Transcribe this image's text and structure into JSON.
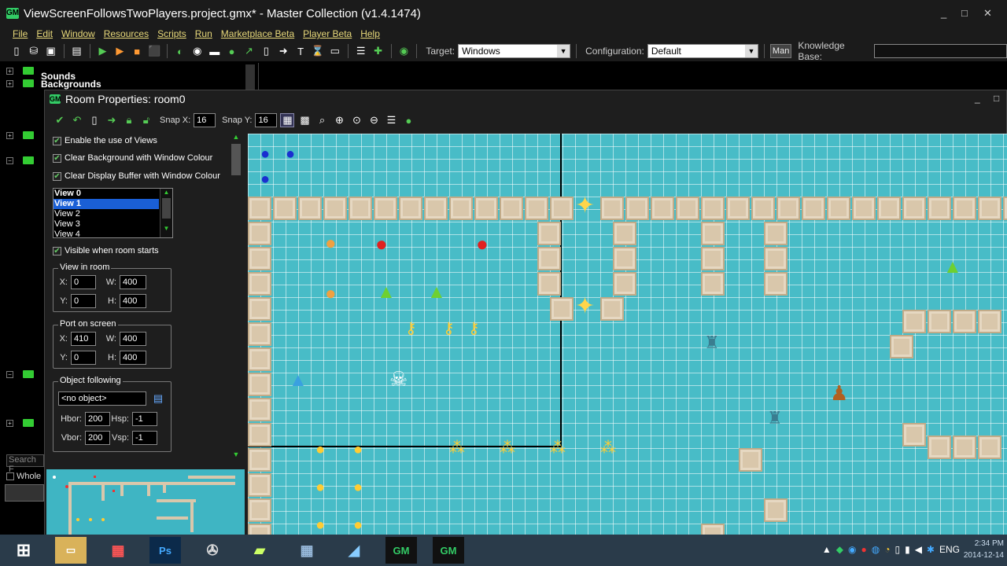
{
  "app": {
    "title": "ViewScreenFollowsTwoPlayers.project.gmx* - Master Collection (v1.4.1474)",
    "logo_text": "GM",
    "window_controls": [
      "_",
      "□",
      "✕"
    ]
  },
  "menu": [
    "File",
    "Edit",
    "Window",
    "Resources",
    "Scripts",
    "Run",
    "Marketplace Beta",
    "Player Beta",
    "Help"
  ],
  "toolbar": {
    "target_label": "Target:",
    "target_value": "Windows",
    "config_label": "Configuration:",
    "config_value": "Default",
    "man_label": "Man",
    "kb_label": "Knowledge Base:",
    "kb_value": ""
  },
  "tree": {
    "items": [
      {
        "label": "Sounds",
        "expanded": false
      },
      {
        "label": "Backgrounds",
        "expanded": false
      }
    ],
    "search_placeholder": "Search F",
    "whole_word_label": "Whole"
  },
  "room": {
    "title": "Room Properties: room0",
    "window_controls": [
      "_",
      "□"
    ],
    "snap_x_label": "Snap X:",
    "snap_x": "16",
    "snap_y_label": "Snap Y:",
    "snap_y": "16",
    "enable_views_label": "Enable the use of Views",
    "clear_bg_label": "Clear Background with Window Colour",
    "clear_display_label": "Clear Display Buffer with Window Colour",
    "views": [
      "View 0",
      "View 1",
      "View 2",
      "View 3",
      "View 4"
    ],
    "selected_view": 1,
    "visible_label": "Visible when room starts",
    "view_in_room": {
      "title": "View in room",
      "x_label": "X:",
      "x": "0",
      "y_label": "Y:",
      "y": "0",
      "w_label": "W:",
      "w": "400",
      "h_label": "H:",
      "h": "400"
    },
    "port_on_screen": {
      "title": "Port on screen",
      "x_label": "X:",
      "x": "410",
      "y_label": "Y:",
      "y": "0",
      "w_label": "W:",
      "w": "400",
      "h_label": "H:",
      "h": "400"
    },
    "object_following": {
      "title": "Object following",
      "object": "<no object>",
      "hbor_label": "Hbor:",
      "hbor": "200",
      "hsp_label": "Hsp:",
      "hsp": "-1",
      "vbor_label": "Vbor:",
      "vbor": "200",
      "vsp_label": "Vsp:",
      "vsp": "-1"
    }
  },
  "taskbar": {
    "apps": [
      "windows-start",
      "file-explorer",
      "apps-grid",
      "photoshop",
      "recorder",
      "sticky-notes",
      "calculator",
      "notes",
      "gamemaker-1",
      "gamemaker-2"
    ],
    "ps_label": "Ps",
    "tray_lang": "ENG",
    "clock_time": "2:34 PM",
    "clock_date": "2014-12-14"
  }
}
